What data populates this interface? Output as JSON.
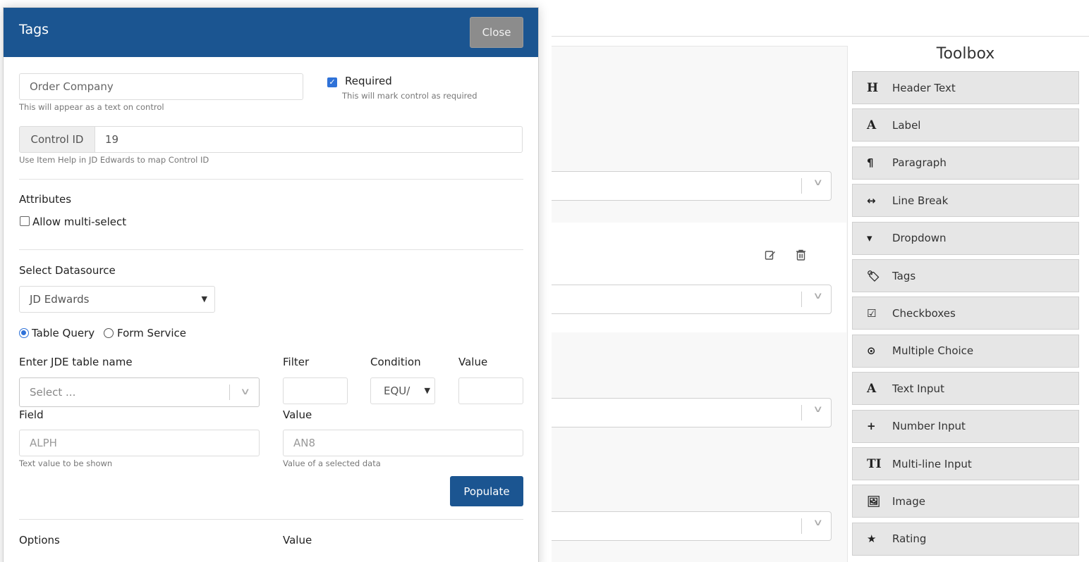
{
  "modal": {
    "title": "Tags",
    "close_label": "Close",
    "text_field": {
      "value": "Order Company",
      "help": "This will appear as a text on control"
    },
    "required": {
      "label": "Required",
      "checked": true,
      "help": "This will mark control as required"
    },
    "control_id": {
      "label": "Control ID",
      "value": "19",
      "help": "Use Item Help in JD Edwards to map Control ID"
    },
    "attributes": {
      "heading": "Attributes",
      "multi_select_label": "Allow multi-select",
      "multi_select_checked": false
    },
    "datasource": {
      "heading": "Select Datasource",
      "selected": "JD Edwards",
      "radio_table_query": "Table Query",
      "radio_form_service": "Form Service",
      "selected_radio": "Table Query"
    },
    "query": {
      "table_label": "Enter JDE table name",
      "table_placeholder": "Select ...",
      "filter_label": "Filter",
      "filter_value": "",
      "condition_label": "Condition",
      "condition_selected": "EQU/",
      "value_label": "Value",
      "value_value": ""
    },
    "field": {
      "label": "Field",
      "placeholder": "ALPH",
      "help": "Text value to be shown"
    },
    "field_value": {
      "label": "Value",
      "placeholder": "AN8",
      "help": "Value of a selected data"
    },
    "populate_label": "Populate",
    "options": {
      "options_label": "Options",
      "value_label": "Value"
    }
  },
  "toolbox": {
    "title": "Toolbox",
    "items": [
      {
        "icon": "header-icon",
        "glyph": "H",
        "label": "Header Text"
      },
      {
        "icon": "label-icon",
        "glyph": "A",
        "label": "Label"
      },
      {
        "icon": "paragraph-icon",
        "glyph": "¶",
        "label": "Paragraph"
      },
      {
        "icon": "line-break-icon",
        "glyph": "↔",
        "label": "Line Break"
      },
      {
        "icon": "dropdown-icon",
        "glyph": "▾",
        "label": "Dropdown"
      },
      {
        "icon": "tags-icon",
        "glyph": "🏷",
        "label": "Tags"
      },
      {
        "icon": "checkbox-icon",
        "glyph": "☑",
        "label": "Checkboxes"
      },
      {
        "icon": "radio-icon",
        "glyph": "⊙",
        "label": "Multiple Choice"
      },
      {
        "icon": "text-input-icon",
        "glyph": "A",
        "label": "Text Input"
      },
      {
        "icon": "plus-icon",
        "glyph": "+",
        "label": "Number Input"
      },
      {
        "icon": "multiline-icon",
        "glyph": "TI",
        "label": "Multi-line Input"
      },
      {
        "icon": "image-icon",
        "glyph": "🖼",
        "label": "Image"
      },
      {
        "icon": "star-icon",
        "glyph": "★",
        "label": "Rating"
      }
    ]
  },
  "canvas": {
    "edit_icon": "edit-icon",
    "delete_icon": "trash-icon"
  }
}
